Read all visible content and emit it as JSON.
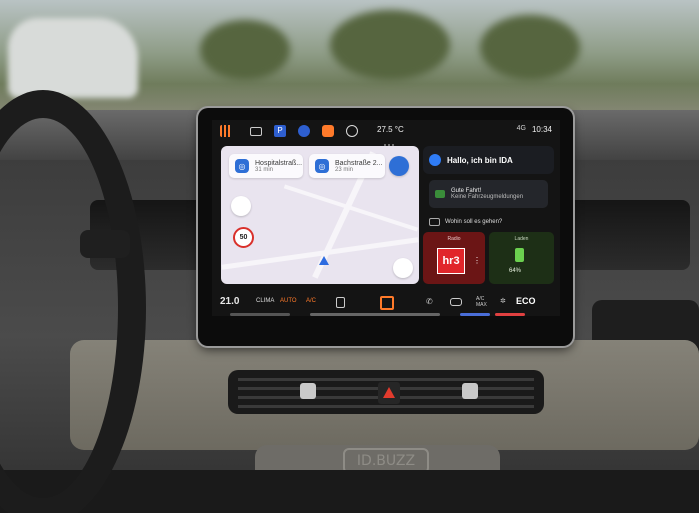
{
  "statusbar": {
    "temperature": "27.5 °C",
    "time": "10:34",
    "signal": "4G"
  },
  "map": {
    "card1": {
      "title": "Hospitalstraß...",
      "eta": "31 min"
    },
    "card2": {
      "title": "Bachstraße 2...",
      "eta": "23 min"
    },
    "speed_limit": "50"
  },
  "assistant": {
    "greeting": "Hallo, ich bin IDA",
    "message_line1": "Gute Fahrt!",
    "message_line2": "Keine Fahrzeugmeldungen",
    "prompt": "Wohin soll es gehen?"
  },
  "radio": {
    "label": "Radio",
    "station": "hr3"
  },
  "charging": {
    "label": "Laden",
    "percent": "64%"
  },
  "bottom_bar": {
    "temperature": "21.0",
    "clima": "CLIMA",
    "auto": "AUTO",
    "ac": "A/C",
    "ac2_top": "A/C",
    "ac2_bottom": "MAX",
    "eco": "ECO"
  },
  "console": {
    "badge": "ID.BUZZ"
  },
  "colors": {
    "accent": "#ff7a2a",
    "ida_blue": "#2f7cf6",
    "radio_red": "#e1262b",
    "charge_green": "#6bd04f"
  }
}
